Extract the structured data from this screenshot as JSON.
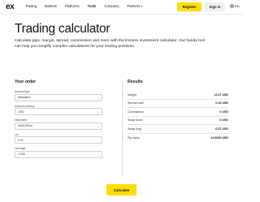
{
  "nav": {
    "logo": "ex",
    "links": [
      {
        "label": "Trading",
        "active": false,
        "dropdown": false
      },
      {
        "label": "Markets",
        "active": false,
        "dropdown": false
      },
      {
        "label": "Platforms",
        "active": false,
        "dropdown": false
      },
      {
        "label": "Tools",
        "active": true,
        "dropdown": false
      },
      {
        "label": "Company",
        "active": false,
        "dropdown": false
      },
      {
        "label": "Partners",
        "active": false,
        "dropdown": true
      }
    ],
    "register": "Register",
    "signin": "Sign in",
    "language": "EN"
  },
  "hero": {
    "title": "Trading calculator",
    "subtitle": "Calculate pips, margin, spread, commission and more with the Exness investment calculator. Our handy tool can help you simplify complex calculations for your trading positions."
  },
  "form": {
    "title": "Your order",
    "fields": [
      {
        "label": "Account type",
        "value": "Standard"
      },
      {
        "label": "Account currency",
        "value": "USD"
      },
      {
        "label": "Instrument",
        "value": "XAUUSDm"
      },
      {
        "label": "Lot",
        "value": "0.01"
      },
      {
        "label": "Leverage",
        "value": "1:200"
      }
    ]
  },
  "results": {
    "title": "Results",
    "rows": [
      {
        "label": "Margin",
        "value": "13.37 USD"
      },
      {
        "label": "Spread cost*",
        "value": "0.16 USD"
      },
      {
        "label": "Commission",
        "value": "0 USD"
      },
      {
        "label": "Swap short",
        "value": "0 USD"
      },
      {
        "label": "Swap long",
        "value": "-0.37 USD"
      },
      {
        "label": "Pip value",
        "value": "0.01000 USD"
      }
    ]
  },
  "calculate": "Calculate",
  "colors": {
    "accent": "#ffde02",
    "text": "#141414",
    "border": "#cfcfcf"
  }
}
